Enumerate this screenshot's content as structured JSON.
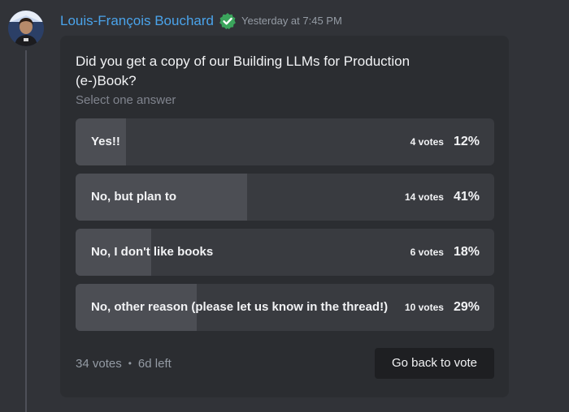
{
  "message": {
    "author": "Louis-François Bouchard",
    "timestamp": "Yesterday at 7:45 PM",
    "verified_icon": "verified-check-icon",
    "avatar_icon": "avatar"
  },
  "poll": {
    "question": "Did you get a copy of our Building LLMs for Production (e-)Book?",
    "hint": "Select one answer",
    "answers": [
      {
        "label": "Yes!!",
        "votes": "4 votes",
        "percent": "12%",
        "fraction": 0.12
      },
      {
        "label": "No, but plan to",
        "votes": "14 votes",
        "percent": "41%",
        "fraction": 0.41
      },
      {
        "label": "No, I don't like books",
        "votes": "6 votes",
        "percent": "18%",
        "fraction": 0.18
      },
      {
        "label": "No, other reason (please let us know in the thread!)",
        "votes": "10 votes",
        "percent": "29%",
        "fraction": 0.29
      }
    ],
    "total_votes": "34 votes",
    "separator": "•",
    "time_left": "6d left",
    "button_label": "Go back to vote"
  },
  "colors": {
    "author": "#4aa3ea",
    "verified": "#3ba55c",
    "panel": "#2b2d31",
    "answer_bg": "#393b40",
    "answer_fill": "#4c4e54",
    "button_bg": "#1e1f22"
  }
}
